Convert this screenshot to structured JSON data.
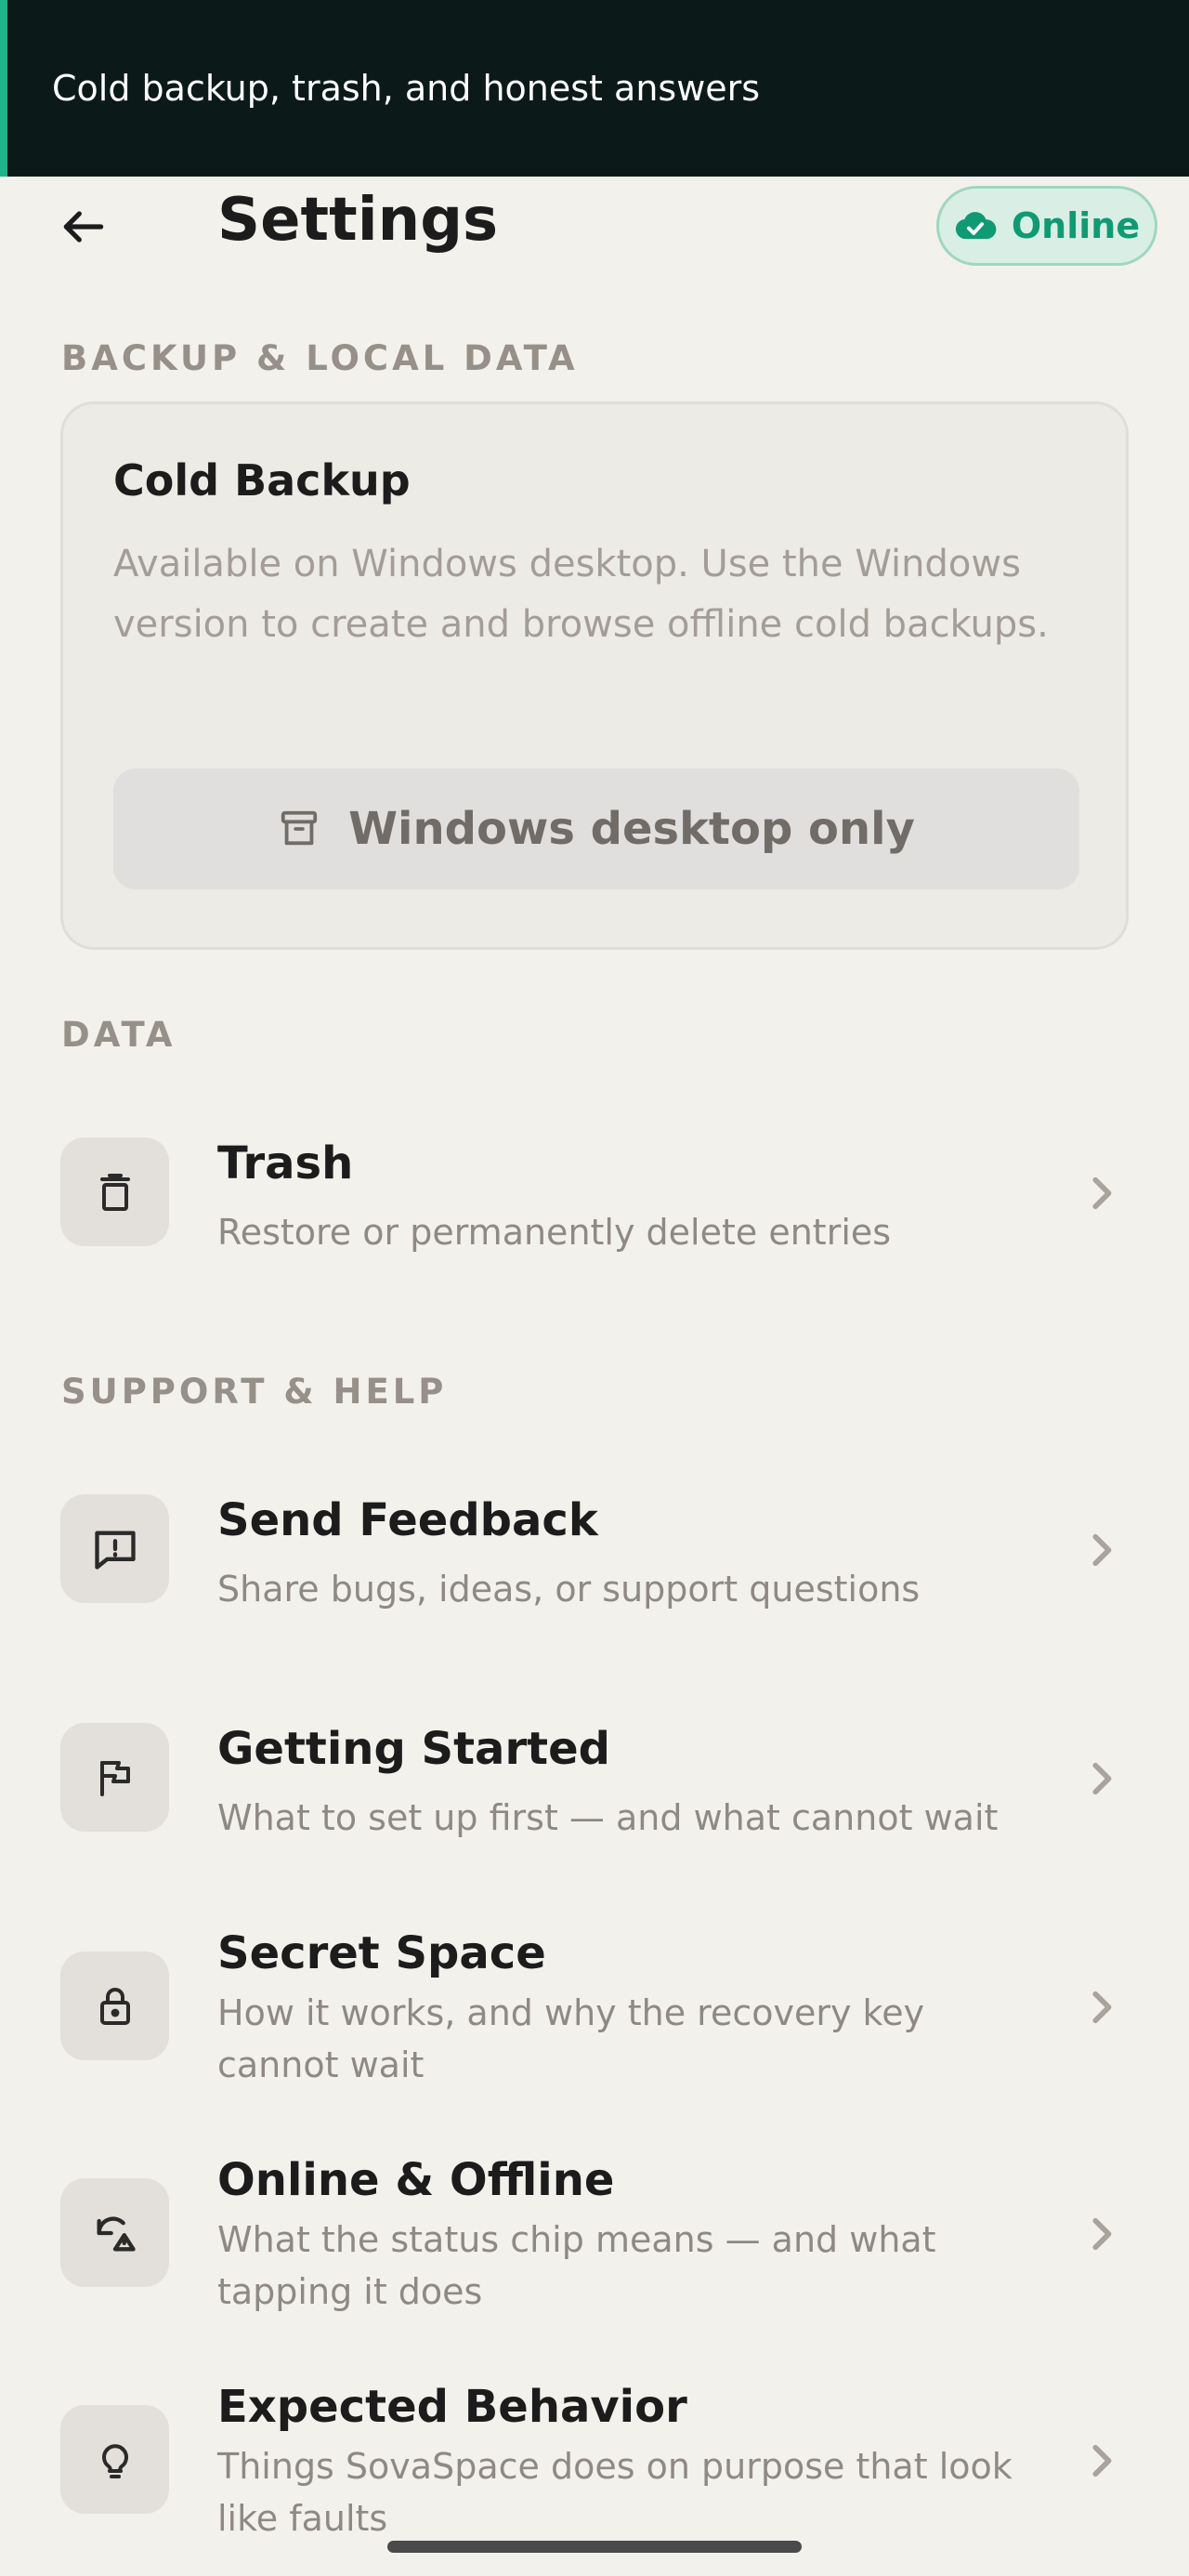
{
  "banner": {
    "text": "Cold backup, trash, and honest answers"
  },
  "appbar": {
    "back_icon": "arrow-left-icon",
    "title": "Settings",
    "status_chip": {
      "label": "Online",
      "icon": "cloud-check-icon",
      "color": "#109a73"
    }
  },
  "sections": {
    "backup": "BACKUP & LOCAL DATA",
    "data": "DATA",
    "support": "SUPPORT & HELP"
  },
  "cold_backup": {
    "title": "Cold Backup",
    "description": "Available on Windows desktop. Use the Windows version to create and browse offline cold backups.",
    "button_label": "Windows desktop only",
    "button_icon": "archive-icon"
  },
  "data_items": [
    {
      "icon": "trash-icon",
      "title": "Trash",
      "subtitle": "Restore or permanently delete entries"
    }
  ],
  "support_items": [
    {
      "icon": "feedback-icon",
      "title": "Send Feedback",
      "subtitle": "Share bugs, ideas, or support questions"
    },
    {
      "icon": "flag-icon",
      "title": "Getting Started",
      "subtitle": "What to set up first — and what cannot wait"
    },
    {
      "icon": "lock-icon",
      "title": "Secret Space",
      "subtitle": "How it works, and why the recovery key cannot wait"
    },
    {
      "icon": "cloud-sync-icon",
      "title": "Online & Offline",
      "subtitle": "What the status chip means — and what tapping it does"
    },
    {
      "icon": "lightbulb-icon",
      "title": "Expected Behavior",
      "subtitle": "Things SovaSpace does on purpose that look like faults"
    }
  ]
}
